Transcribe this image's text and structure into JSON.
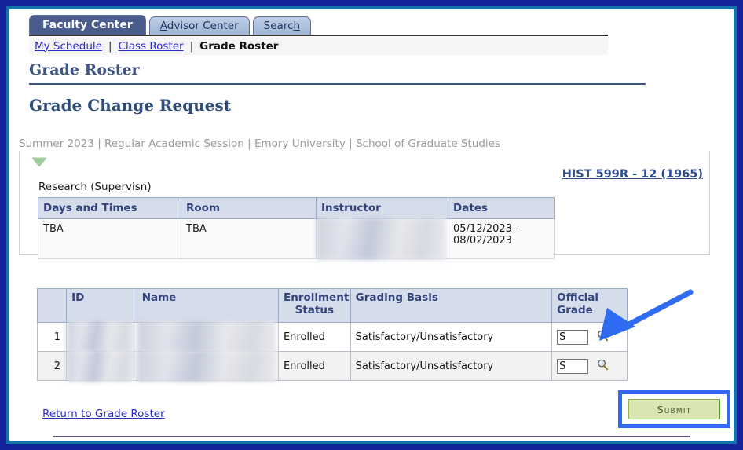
{
  "window": {
    "outer_border_color": "#15239b",
    "inner_border_color": "#1472ab"
  },
  "tabs": [
    {
      "label": "Faculty Center",
      "active": true,
      "accesskey": ""
    },
    {
      "label": "Advisor Center",
      "active": false,
      "accesskey": "A"
    },
    {
      "label": "Search",
      "active": false,
      "accesskey": "h"
    }
  ],
  "breadcrumb": {
    "links": [
      "My Schedule",
      "Class Roster"
    ],
    "separator": "|",
    "current": "Grade Roster"
  },
  "headings": {
    "page_title": "Grade Roster",
    "section_title": "Grade Change Request"
  },
  "term_line": "Summer 2023 | Regular Academic Session | Emory University | School of Graduate Studies",
  "course_panel": {
    "collapse_icon": "triangle-down-icon",
    "course_link": "HIST 599R - 12 (1965)",
    "component": "Research (Supervisn)",
    "meeting_table": {
      "headers": [
        "Days and Times",
        "Room",
        "Instructor",
        "Dates"
      ],
      "rows": [
        {
          "days_and_times": "TBA",
          "room": "TBA",
          "instructor": "",
          "instructor_redacted": true,
          "dates": "05/12/2023 - 08/02/2023"
        }
      ]
    }
  },
  "roster": {
    "headers": [
      "",
      "ID",
      "Name",
      "Enrollment Status",
      "Grading Basis",
      "Official Grade"
    ],
    "lookup_icon": "magnifier-icon",
    "rows": [
      {
        "num": "1",
        "id": "",
        "name": "",
        "redacted": true,
        "enrollment_status": "Enrolled",
        "grading_basis": "Satisfactory/Unsatisfactory",
        "official_grade": "S"
      },
      {
        "num": "2",
        "id": "",
        "name": "",
        "redacted": true,
        "enrollment_status": "Enrolled",
        "grading_basis": "Satisfactory/Unsatisfactory",
        "official_grade": "S"
      }
    ]
  },
  "footer": {
    "return_link": "Return to Grade Roster",
    "submit_label": "Submit"
  },
  "annotations": {
    "arrow_color": "#2f6bf0",
    "highlight_box_color": "#2f6bf0"
  },
  "colors": {
    "tab_active_bg": "#4a5c8c",
    "tab_inactive_bg": "#a9bcd8",
    "link": "#2c2cc9",
    "heading": "#3f5487",
    "table_header_bg": "#d5dcea",
    "submit_bg": "#d9e6b2"
  }
}
